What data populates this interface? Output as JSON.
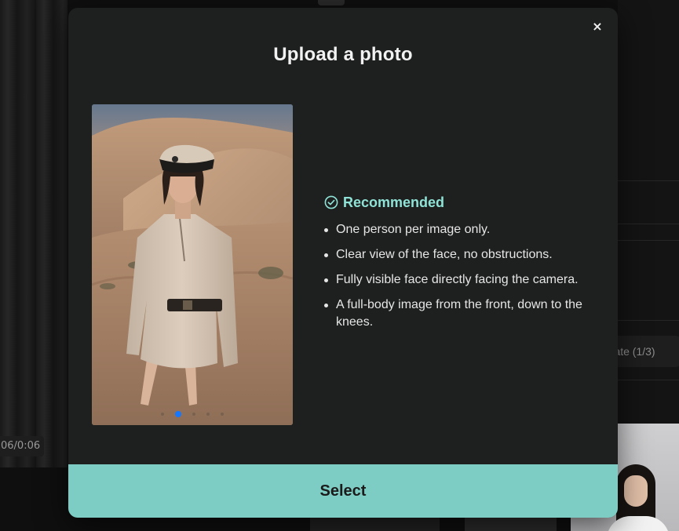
{
  "background": {
    "video_time": "06/0:06",
    "generate_label": "erate (1/3)"
  },
  "modal": {
    "title": "Upload a photo",
    "close_label": "×",
    "recommended": {
      "heading": "Recommended",
      "items": [
        "One person per image only.",
        "Clear view of the face, no obstructions.",
        "Fully visible face directly facing the camera.",
        "A full-body image from the front, down to the knees."
      ]
    },
    "carousel": {
      "total": 5,
      "active_index": 1
    },
    "select_label": "Select"
  },
  "colors": {
    "modal_bg": "#1e1f1f",
    "accent_teal": "#7ecdc4",
    "recommended_text": "#8fe3d6",
    "active_dot": "#1677ff"
  }
}
